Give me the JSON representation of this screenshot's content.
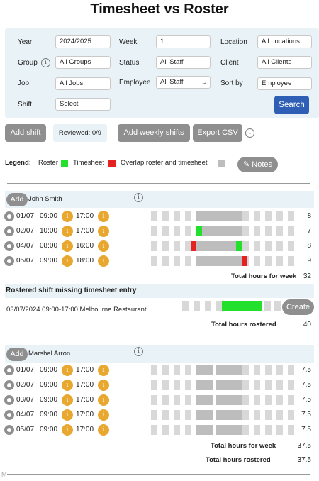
{
  "title": "Timesheet vs Roster",
  "filters": {
    "year_label": "Year",
    "year_value": "2024/2025",
    "week_label": "Week",
    "week_value": "1",
    "location_label": "Location",
    "location_value": "All Locations",
    "group_label": "Group",
    "group_value": "All Groups",
    "status_label": "Status",
    "status_value": "All Staff",
    "client_label": "Client",
    "client_value": "All Clients",
    "job_label": "Job",
    "job_value": "All Jobs",
    "employee_label": "Employee",
    "employee_value": "All Staff",
    "sortby_label": "Sort by",
    "sortby_value": "Employee",
    "shift_label": "Shift",
    "shift_value": "Select",
    "search_label": "Search"
  },
  "toolbar": {
    "add_shift": "Add shift",
    "reviewed": "Reviewed: 0/9",
    "add_weekly": "Add weekly shifts",
    "export_csv": "Export CSV"
  },
  "legend": {
    "title": "Legend:",
    "roster": "Roster",
    "timesheet": "Timesheet",
    "overlap": "Overlap roster and timesheet",
    "notes": "Notes",
    "colors": {
      "roster": "#22e02c",
      "timesheet": "#e52222",
      "overlap": "#bdbdbd"
    }
  },
  "info_glyph": "i",
  "employees": [
    {
      "add_label": "Add",
      "name": "John Smith",
      "rows": [
        {
          "date": "01/07",
          "start": "09:00",
          "end": "17:00",
          "hours": "8"
        },
        {
          "date": "02/07",
          "start": "10:00",
          "end": "17:00",
          "hours": "7"
        },
        {
          "date": "04/07",
          "start": "08:00",
          "end": "16:00",
          "hours": "8"
        },
        {
          "date": "05/07",
          "start": "09:00",
          "end": "18:00",
          "hours": "9"
        }
      ],
      "total_week_label": "Total hours for week",
      "total_week": "32"
    },
    {
      "add_label": "Add",
      "name": "Marshal Arron",
      "rows": [
        {
          "date": "01/07",
          "start": "09:00",
          "end": "17:00",
          "hours": "7.5"
        },
        {
          "date": "02/07",
          "start": "09:00",
          "end": "17:00",
          "hours": "7.5"
        },
        {
          "date": "03/07",
          "start": "09:00",
          "end": "17:00",
          "hours": "7.5"
        },
        {
          "date": "04/07",
          "start": "09:00",
          "end": "17:00",
          "hours": "7.5"
        },
        {
          "date": "05/07",
          "start": "09:00",
          "end": "17:00",
          "hours": "7.5"
        }
      ],
      "total_week_label": "Total hours for week",
      "total_week": "37.5",
      "total_rostered_label": "Total hours rostered",
      "total_rostered": "37.5"
    }
  ],
  "missing": {
    "header": "Rostered shift missing timesheet entry",
    "entry": "03/07/2024  09:00-17:00 Melbourne Restaurant",
    "create_label": "Create",
    "total_rostered_label": "Total hours rostered",
    "total_rostered": "40"
  },
  "footer_mark": "M"
}
